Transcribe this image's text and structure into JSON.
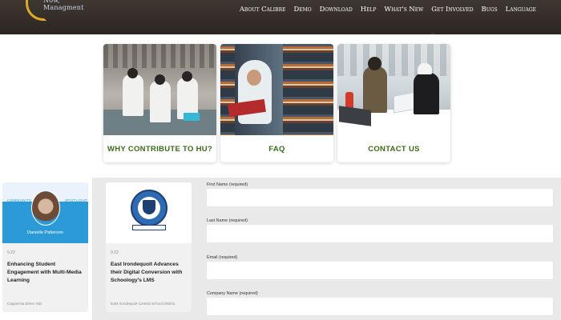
{
  "header": {
    "logo_text": "Now, Managment",
    "nav": [
      "About Calibre",
      "Demo",
      "Download",
      "Help",
      "What's New",
      "Get Involved",
      "Bugs",
      "Language"
    ]
  },
  "cards": [
    {
      "label": "WHY CONTRIBUTE TO HU?",
      "photo": "lab-photo"
    },
    {
      "label": "FAQ",
      "photo": "library-photo"
    },
    {
      "label": "CONTACT US",
      "photo": "office-photo"
    }
  ],
  "resources": [
    {
      "tag_left": "COMMUNITY",
      "tag_right": "SPOTLIGHT",
      "name": "Danielle Patterson",
      "date": "9.22",
      "title": "Enhancing Student Engagement with Multi-Media Learning",
      "source": "Cappernia Elmer ISD"
    },
    {
      "date": "9.22",
      "title": "East Irondequoit Advances their Digital Conversion with Schoology's LMS",
      "source": "East Irondequoit Central School District"
    }
  ],
  "form": {
    "fields": [
      {
        "label": "First Name (required)",
        "value": ""
      },
      {
        "label": "Last Name (required)",
        "value": ""
      },
      {
        "label": "Email (required)",
        "value": ""
      },
      {
        "label": "Company Name (required)",
        "value": ""
      }
    ]
  },
  "colors": {
    "header_bg": "#2c2521",
    "card_label": "#3c6a1a",
    "band_bg": "#e9e9e9",
    "accent_blue": "#2d9ad8"
  }
}
